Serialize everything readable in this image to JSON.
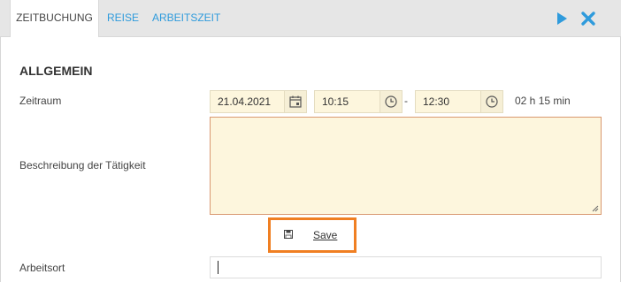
{
  "tabs": [
    {
      "label": "ZEITBUCHUNG",
      "active": true
    },
    {
      "label": "REISE",
      "active": false
    },
    {
      "label": "ARBEITSZEIT",
      "active": false
    }
  ],
  "toolbar": {
    "play_icon": "play-icon",
    "close_icon": "close-icon",
    "accent": "#2f9bdc"
  },
  "section": {
    "title": "ALLGEMEIN"
  },
  "zeitraum": {
    "label": "Zeitraum",
    "date": "21.04.2021",
    "start_time": "10:15",
    "separator": "-",
    "end_time": "12:30",
    "duration": "02 h 15 min"
  },
  "beschreibung": {
    "label": "Beschreibung der Tätigkeit",
    "value": ""
  },
  "save": {
    "label": "Save",
    "icon": "floppy-disk-icon",
    "highlight_color": "#f07f22"
  },
  "arbeitsort": {
    "label": "Arbeitsort",
    "value": ""
  }
}
